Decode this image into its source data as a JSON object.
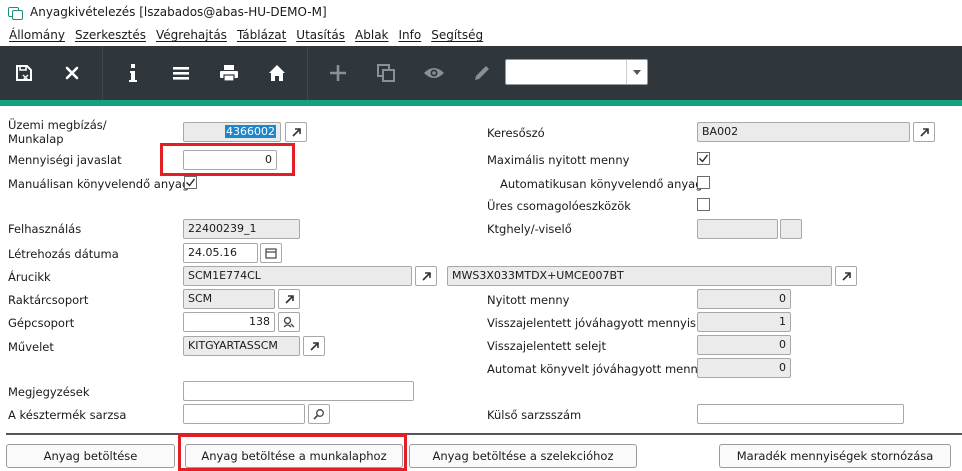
{
  "window": {
    "title": "Anyagkivételezés  [lszabados@abas-HU-DEMO-M]"
  },
  "menu": [
    "Állomány",
    "Szerkesztés",
    "Végrehajtás",
    "Táblázat",
    "Utasítás",
    "Ablak",
    "Info",
    "Segítség"
  ],
  "toolbar": {
    "icons": [
      "save-icon",
      "close-icon",
      "info-icon",
      "menu-icon",
      "print-icon",
      "home-icon",
      "plus-icon",
      "copy-icon",
      "eye-icon",
      "pencil-icon"
    ],
    "dropdown_value": ""
  },
  "form": {
    "work_order_label_1": "Üzemi megbízás/",
    "work_order_label_2": "Munkalap",
    "work_order_value": "4366002",
    "suggested_qty_label": "Mennyiségi javaslat",
    "suggested_qty_value": "0",
    "manual_post_label": "Manuálisan könyvelendő anyag",
    "manual_post_checked": true,
    "search_word_label": "Keresőszó",
    "search_word_value": "BA002",
    "max_open_qty_label": "Maximális nyitott menny",
    "max_open_qty_checked": true,
    "auto_post_label": "Automatikusan könyvelendő anyag",
    "auto_post_checked": false,
    "empty_packaging_label": "Üres csomagolóeszközök",
    "empty_packaging_checked": false,
    "usage_label": "Felhasználás",
    "usage_value": "22400239_1",
    "created_date_label": "Létrehozás dátuma",
    "created_date_value": "24.05.16",
    "cost_center_label": "Ktghely/-viselő",
    "cost_center_value": "",
    "article_label": "Árucikk",
    "article_code": "SCM1E774CL",
    "article_name": "MWS3X033MTDX+UMCE007BT",
    "warehouse_group_label": "Raktárcsoport",
    "warehouse_group_value": "SCM",
    "machine_group_label": "Gépcsoport",
    "machine_group_value": "138",
    "operation_label": "Művelet",
    "operation_value": "KITGYARTASSCM",
    "open_qty_label": "Nyitott menny",
    "open_qty_value": "0",
    "reported_approved_label": "Visszajelentett jóváhagyott mennyis",
    "reported_approved_value": "1",
    "reported_scrap_label": "Visszajelentett selejt",
    "reported_scrap_value": "0",
    "auto_posted_approved_label": "Automat könyvelt jóváhagyott menny",
    "auto_posted_approved_value": "0",
    "notes_label": "Megjegyzések",
    "notes_value": "",
    "finished_batch_label": "A késztermék sarzsa",
    "finished_batch_value": "",
    "external_batch_label": "Külső sarzsszám",
    "external_batch_value": ""
  },
  "buttons": {
    "load_material": "Anyag betöltése",
    "load_material_workorder": "Anyag betöltése a munkalaphoz",
    "load_material_selection": "Anyag betöltése a szelekcióhoz",
    "cancel_remaining": "Maradék mennyiségek stornózása"
  },
  "colors": {
    "toolbar_bg": "#2f363c",
    "accent_teal": "#14a083",
    "highlight_red": "#e31e24",
    "selection_blue": "#1f87c9"
  }
}
